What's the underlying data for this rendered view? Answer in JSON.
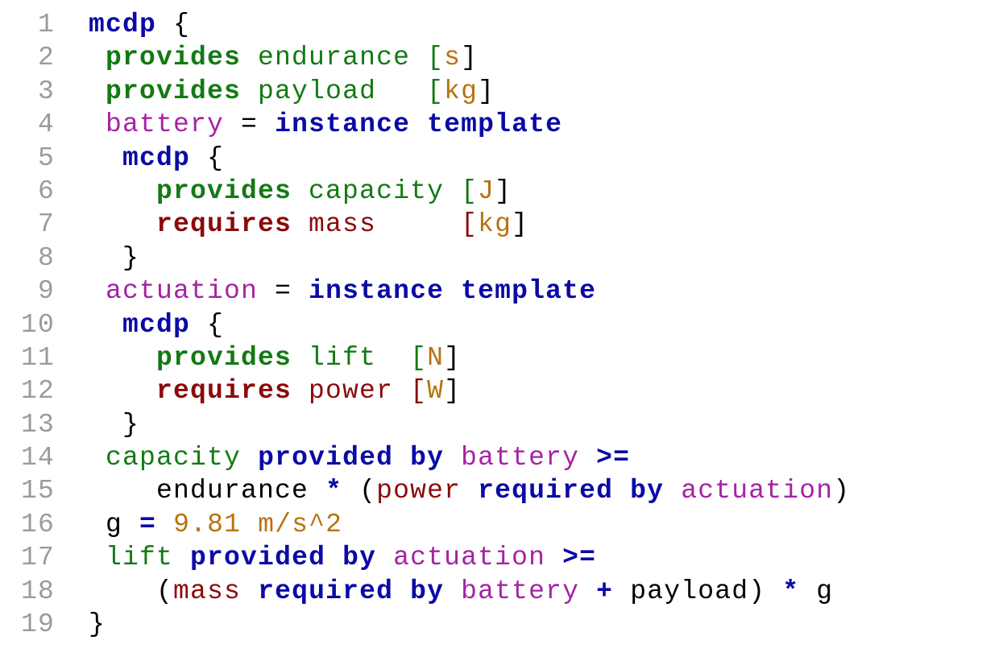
{
  "colors": {
    "keyword_blue": "#0a0aa6",
    "provides_green": "#137a13",
    "requires_red": "#8b0a0a",
    "instance_magenta": "#a523a5",
    "unit_orange": "#b8720f",
    "plain_black": "#000000",
    "line_number_gray": "#9b9b9b"
  },
  "code": {
    "lines": [
      {
        "num": "1",
        "indent": "",
        "tokens": [
          {
            "t": "mcdp",
            "c": "keyword_blue",
            "b": true
          },
          {
            "t": " {",
            "c": "plain_black",
            "b": false
          }
        ]
      },
      {
        "num": "2",
        "indent": " ",
        "tokens": [
          {
            "t": "provides",
            "c": "provides_green",
            "b": true
          },
          {
            "t": " endurance [",
            "c": "provides_green",
            "b": false
          },
          {
            "t": "s",
            "c": "unit_orange",
            "b": false
          },
          {
            "t": "]",
            "c": "plain_black",
            "b": false
          }
        ]
      },
      {
        "num": "3",
        "indent": " ",
        "tokens": [
          {
            "t": "provides",
            "c": "provides_green",
            "b": true
          },
          {
            "t": " payload   [",
            "c": "provides_green",
            "b": false
          },
          {
            "t": "kg",
            "c": "unit_orange",
            "b": false
          },
          {
            "t": "]",
            "c": "plain_black",
            "b": false
          }
        ]
      },
      {
        "num": "4",
        "indent": " ",
        "tokens": [
          {
            "t": "battery",
            "c": "instance_magenta",
            "b": false
          },
          {
            "t": " = ",
            "c": "plain_black",
            "b": false
          },
          {
            "t": "instance template",
            "c": "keyword_blue",
            "b": true
          }
        ]
      },
      {
        "num": "5",
        "indent": "  ",
        "tokens": [
          {
            "t": "mcdp",
            "c": "keyword_blue",
            "b": true
          },
          {
            "t": " {",
            "c": "plain_black",
            "b": false
          }
        ]
      },
      {
        "num": "6",
        "indent": "    ",
        "tokens": [
          {
            "t": "provides",
            "c": "provides_green",
            "b": true
          },
          {
            "t": " capacity [",
            "c": "provides_green",
            "b": false
          },
          {
            "t": "J",
            "c": "unit_orange",
            "b": false
          },
          {
            "t": "]",
            "c": "plain_black",
            "b": false
          }
        ]
      },
      {
        "num": "7",
        "indent": "    ",
        "tokens": [
          {
            "t": "requires",
            "c": "requires_red",
            "b": true
          },
          {
            "t": " mass     [",
            "c": "requires_red",
            "b": false
          },
          {
            "t": "kg",
            "c": "unit_orange",
            "b": false
          },
          {
            "t": "]",
            "c": "plain_black",
            "b": false
          }
        ]
      },
      {
        "num": "8",
        "indent": "  ",
        "tokens": [
          {
            "t": "}",
            "c": "plain_black",
            "b": false
          }
        ]
      },
      {
        "num": "9",
        "indent": " ",
        "tokens": [
          {
            "t": "actuation",
            "c": "instance_magenta",
            "b": false
          },
          {
            "t": " = ",
            "c": "plain_black",
            "b": false
          },
          {
            "t": "instance template",
            "c": "keyword_blue",
            "b": true
          }
        ]
      },
      {
        "num": "10",
        "indent": "  ",
        "tokens": [
          {
            "t": "mcdp",
            "c": "keyword_blue",
            "b": true
          },
          {
            "t": " {",
            "c": "plain_black",
            "b": false
          }
        ]
      },
      {
        "num": "11",
        "indent": "    ",
        "tokens": [
          {
            "t": "provides",
            "c": "provides_green",
            "b": true
          },
          {
            "t": " lift  [",
            "c": "provides_green",
            "b": false
          },
          {
            "t": "N",
            "c": "unit_orange",
            "b": false
          },
          {
            "t": "]",
            "c": "plain_black",
            "b": false
          }
        ]
      },
      {
        "num": "12",
        "indent": "    ",
        "tokens": [
          {
            "t": "requires",
            "c": "requires_red",
            "b": true
          },
          {
            "t": " power [",
            "c": "requires_red",
            "b": false
          },
          {
            "t": "W",
            "c": "unit_orange",
            "b": false
          },
          {
            "t": "]",
            "c": "plain_black",
            "b": false
          }
        ]
      },
      {
        "num": "13",
        "indent": "  ",
        "tokens": [
          {
            "t": "}",
            "c": "plain_black",
            "b": false
          }
        ]
      },
      {
        "num": "14",
        "indent": " ",
        "tokens": [
          {
            "t": "capacity",
            "c": "provides_green",
            "b": false
          },
          {
            "t": " ",
            "c": "plain_black",
            "b": false
          },
          {
            "t": "provided by",
            "c": "keyword_blue",
            "b": true
          },
          {
            "t": " ",
            "c": "plain_black",
            "b": false
          },
          {
            "t": "battery",
            "c": "instance_magenta",
            "b": false
          },
          {
            "t": " ",
            "c": "plain_black",
            "b": false
          },
          {
            "t": ">=",
            "c": "keyword_blue",
            "b": true
          }
        ]
      },
      {
        "num": "15",
        "indent": "    ",
        "tokens": [
          {
            "t": "endurance",
            "c": "plain_black",
            "b": false
          },
          {
            "t": " ",
            "c": "plain_black",
            "b": false
          },
          {
            "t": "*",
            "c": "keyword_blue",
            "b": true
          },
          {
            "t": " (",
            "c": "plain_black",
            "b": false
          },
          {
            "t": "power",
            "c": "requires_red",
            "b": false
          },
          {
            "t": " ",
            "c": "plain_black",
            "b": false
          },
          {
            "t": "required by",
            "c": "keyword_blue",
            "b": true
          },
          {
            "t": " ",
            "c": "plain_black",
            "b": false
          },
          {
            "t": "actuation",
            "c": "instance_magenta",
            "b": false
          },
          {
            "t": ")",
            "c": "plain_black",
            "b": false
          }
        ]
      },
      {
        "num": "16",
        "indent": " ",
        "tokens": [
          {
            "t": "g",
            "c": "plain_black",
            "b": false
          },
          {
            "t": " ",
            "c": "plain_black",
            "b": false
          },
          {
            "t": "=",
            "c": "keyword_blue",
            "b": true
          },
          {
            "t": " 9.81 m/s^2",
            "c": "unit_orange",
            "b": false
          }
        ]
      },
      {
        "num": "17",
        "indent": " ",
        "tokens": [
          {
            "t": "lift",
            "c": "provides_green",
            "b": false
          },
          {
            "t": " ",
            "c": "plain_black",
            "b": false
          },
          {
            "t": "provided by",
            "c": "keyword_blue",
            "b": true
          },
          {
            "t": " ",
            "c": "plain_black",
            "b": false
          },
          {
            "t": "actuation",
            "c": "instance_magenta",
            "b": false
          },
          {
            "t": " ",
            "c": "plain_black",
            "b": false
          },
          {
            "t": ">=",
            "c": "keyword_blue",
            "b": true
          }
        ]
      },
      {
        "num": "18",
        "indent": "    ",
        "tokens": [
          {
            "t": "(",
            "c": "plain_black",
            "b": false
          },
          {
            "t": "mass",
            "c": "requires_red",
            "b": false
          },
          {
            "t": " ",
            "c": "plain_black",
            "b": false
          },
          {
            "t": "required by",
            "c": "keyword_blue",
            "b": true
          },
          {
            "t": " ",
            "c": "plain_black",
            "b": false
          },
          {
            "t": "battery",
            "c": "instance_magenta",
            "b": false
          },
          {
            "t": " ",
            "c": "plain_black",
            "b": false
          },
          {
            "t": "+",
            "c": "keyword_blue",
            "b": true
          },
          {
            "t": " payload) ",
            "c": "plain_black",
            "b": false
          },
          {
            "t": "*",
            "c": "keyword_blue",
            "b": true
          },
          {
            "t": " g",
            "c": "plain_black",
            "b": false
          }
        ]
      },
      {
        "num": "19",
        "indent": "",
        "tokens": [
          {
            "t": "}",
            "c": "plain_black",
            "b": false
          }
        ]
      }
    ]
  }
}
